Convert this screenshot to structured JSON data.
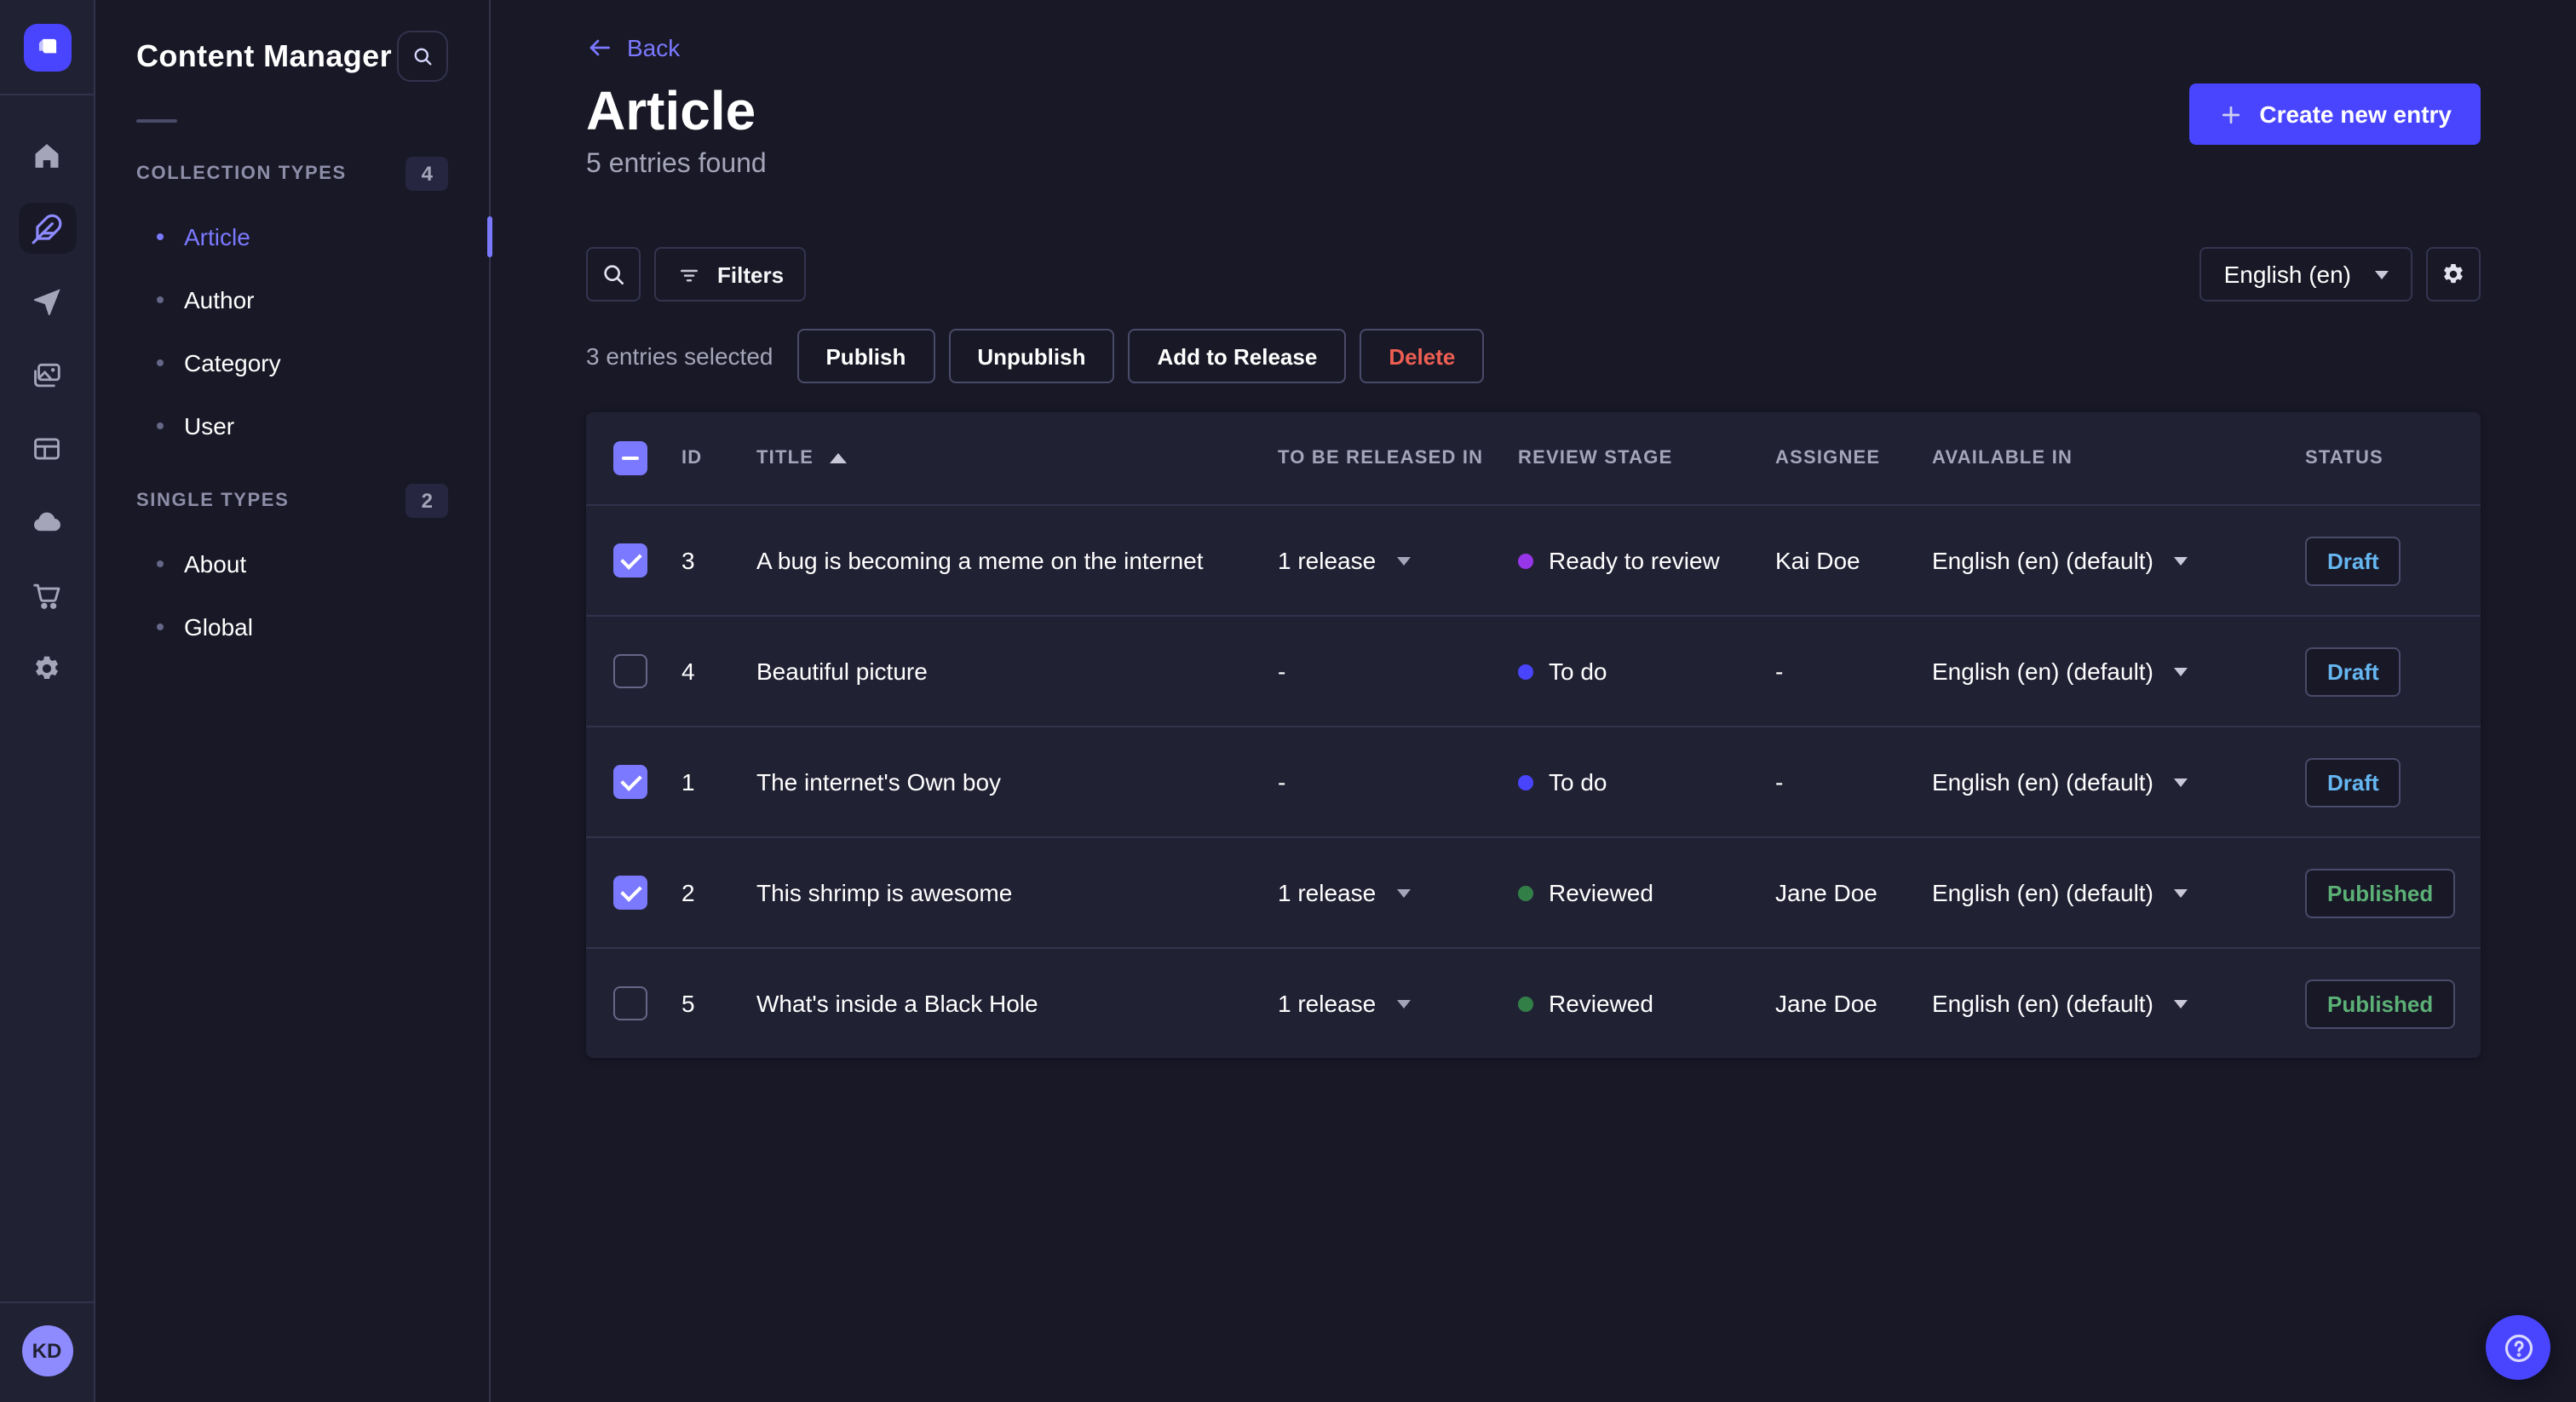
{
  "colors": {
    "primary": "#4945ff",
    "link": "#7b79ff",
    "danger": "#ee5e52",
    "background": "#181826",
    "surface": "#212134",
    "border": "#32324d",
    "text_secondary": "#a5a5ba"
  },
  "icon_sidebar": {
    "avatar_initials": "KD",
    "icons": [
      "strapi-logo",
      "home",
      "content-manager-feather",
      "send",
      "media-library",
      "content-type-builder",
      "cloud",
      "marketplace-cart",
      "settings-gear"
    ],
    "active_icon": "content-manager-feather"
  },
  "content_sidebar": {
    "title": "Content Manager",
    "sections": [
      {
        "label": "COLLECTION TYPES",
        "count": "4",
        "items": [
          {
            "label": "Article",
            "active": true
          },
          {
            "label": "Author",
            "active": false
          },
          {
            "label": "Category",
            "active": false
          },
          {
            "label": "User",
            "active": false
          }
        ]
      },
      {
        "label": "SINGLE TYPES",
        "count": "2",
        "items": [
          {
            "label": "About",
            "active": false
          },
          {
            "label": "Global",
            "active": false
          }
        ]
      }
    ]
  },
  "header": {
    "back_label": "Back",
    "title": "Article",
    "subtitle": "5 entries found",
    "create_label": "Create new entry"
  },
  "toolbar": {
    "filters_label": "Filters",
    "locale_value": "English (en)"
  },
  "selection": {
    "label": "3 entries selected",
    "actions": [
      {
        "label": "Publish",
        "variant": "default"
      },
      {
        "label": "Unpublish",
        "variant": "default"
      },
      {
        "label": "Add to Release",
        "variant": "default"
      },
      {
        "label": "Delete",
        "variant": "danger"
      }
    ]
  },
  "table": {
    "header_checkbox": "indeterminate",
    "sort": {
      "column": "TITLE",
      "direction": "asc"
    },
    "columns": [
      "ID",
      "TITLE",
      "TO BE RELEASED IN",
      "REVIEW STAGE",
      "ASSIGNEE",
      "AVAILABLE IN",
      "STATUS"
    ],
    "status_colors": {
      "Draft": "#66b7f1",
      "Published": "#5cb176"
    },
    "rows": [
      {
        "checked": true,
        "id": "3",
        "title": "A bug is becoming a meme on the internet",
        "release": "1 release",
        "stage": "Ready to review",
        "stage_color": "#9736e8",
        "assignee": "Kai Doe",
        "locale": "English (en) (default)",
        "status": "Draft"
      },
      {
        "checked": false,
        "id": "4",
        "title": "Beautiful picture",
        "release": "-",
        "stage": "To do",
        "stage_color": "#4945ff",
        "assignee": "-",
        "locale": "English (en) (default)",
        "status": "Draft"
      },
      {
        "checked": true,
        "id": "1",
        "title": "The internet's Own boy",
        "release": "-",
        "stage": "To do",
        "stage_color": "#4945ff",
        "assignee": "-",
        "locale": "English (en) (default)",
        "status": "Draft"
      },
      {
        "checked": true,
        "id": "2",
        "title": "This shrimp is awesome",
        "release": "1 release",
        "stage": "Reviewed",
        "stage_color": "#328048",
        "assignee": "Jane Doe",
        "locale": "English (en) (default)",
        "status": "Published"
      },
      {
        "checked": false,
        "id": "5",
        "title": "What's inside a Black Hole",
        "release": "1 release",
        "stage": "Reviewed",
        "stage_color": "#328048",
        "assignee": "Jane Doe",
        "locale": "English (en) (default)",
        "status": "Published"
      }
    ]
  }
}
